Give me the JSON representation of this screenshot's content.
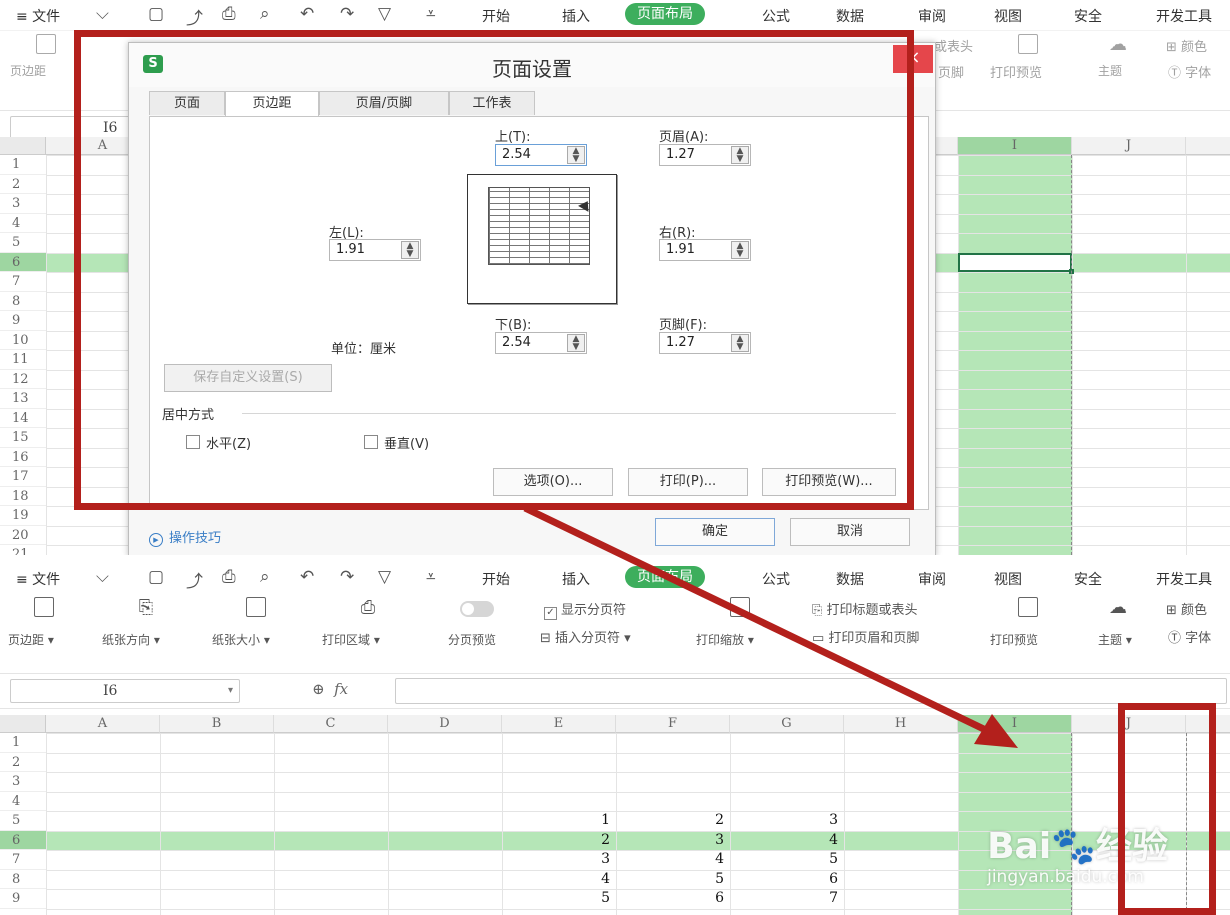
{
  "tabbar": {
    "file_menu": "≡ 文件",
    "tabs": [
      "开始",
      "插入",
      "页面布局",
      "公式",
      "数据",
      "审阅",
      "视图",
      "安全",
      "开发工具"
    ],
    "active_tab": "页面布局"
  },
  "ribbon": {
    "margins": "页边距",
    "orientation": "纸张方向",
    "size": "纸张大小",
    "print_area": "打印区域",
    "page_break_preview": "分页预览",
    "show_page_breaks": "显示分页符",
    "insert_page_break": "插入分页符",
    "print_scale": "打印缩放",
    "print_titles": "打印标题或表头",
    "print_header_footer": "打印页眉和页脚",
    "print_preview": "打印预览",
    "theme": "主题",
    "color": "颜色",
    "font": "字体"
  },
  "formula_bar": {
    "name_box": "I6",
    "fx": "fx"
  },
  "columns": [
    "A",
    "B",
    "C",
    "D",
    "E",
    "F",
    "G",
    "H",
    "I",
    "J"
  ],
  "rows_top": [
    "1",
    "2",
    "3",
    "4",
    "5",
    "6",
    "7",
    "8",
    "9",
    "10",
    "11",
    "12",
    "13",
    "14",
    "15",
    "16",
    "17",
    "18",
    "19",
    "20",
    "21"
  ],
  "rows_bottom": [
    "1",
    "2",
    "3",
    "4",
    "5",
    "6",
    "7",
    "8",
    "9"
  ],
  "cells": {
    "r5": [
      "1",
      "2",
      "3"
    ],
    "r6": [
      "2",
      "3",
      "4"
    ],
    "r7": [
      "3",
      "4",
      "5"
    ],
    "r8": [
      "4",
      "5",
      "6"
    ],
    "r9": [
      "5",
      "6",
      "7"
    ]
  },
  "dialog": {
    "logo": "S",
    "title": "页面设置",
    "close": "×",
    "tabs": [
      "页面",
      "页边距",
      "页眉/页脚",
      "工作表"
    ],
    "active_tab": "页边距",
    "top_label": "上(T):",
    "top_value": "2.54",
    "header_label": "页眉(A):",
    "header_value": "1.27",
    "left_label": "左(L):",
    "left_value": "1.91",
    "right_label": "右(R):",
    "right_value": "1.91",
    "bottom_label": "下(B):",
    "bottom_value": "2.54",
    "footer_label": "页脚(F):",
    "footer_value": "1.27",
    "unit": "单位：厘米",
    "save_custom": "保存自定义设置(S)",
    "center_group": "居中方式",
    "horizontal": "水平(Z)",
    "vertical": "垂直(V)",
    "options_btn": "选项(O)...",
    "print_btn": "打印(P)...",
    "preview_btn": "打印预览(W)...",
    "tips": "操作技巧",
    "ok": "确定",
    "cancel": "取消"
  },
  "watermark": {
    "brand": "Bai🐾经验",
    "url": "jingyan.baidu.com"
  },
  "colors": {
    "accent_green": "#3dae5d",
    "highlight": "#b5e6b7",
    "annotation_red": "#b3201c",
    "close_red": "#e5464b"
  }
}
